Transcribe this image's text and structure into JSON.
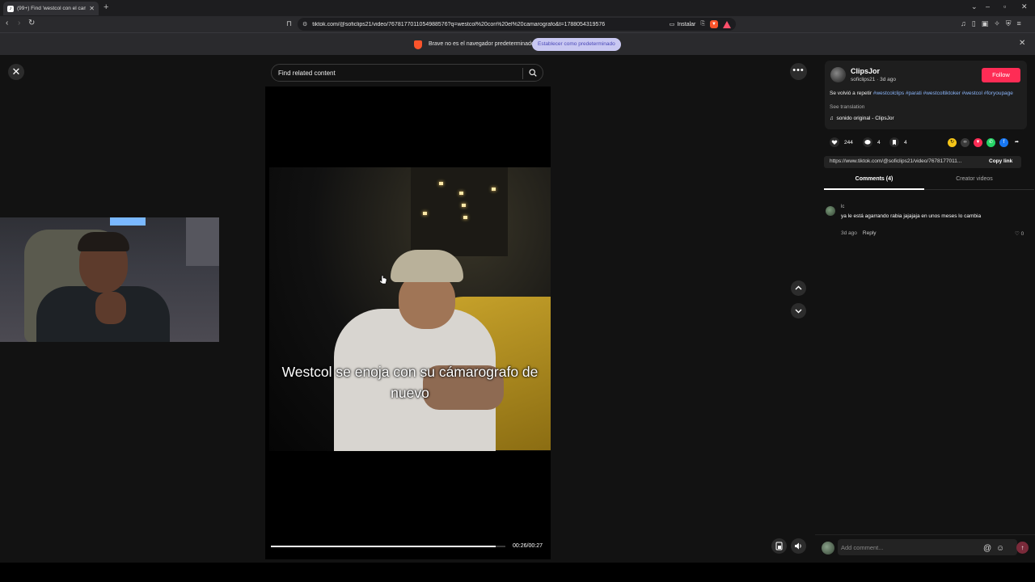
{
  "browser": {
    "tab_title": "(99+) Find 'westcol con el cam",
    "url": "tiktok.com/@soficlips21/video/7678177011054988576?q=westcol%20con%20el%20camarografo&t=1788054319576",
    "install_label": "Instalar",
    "infobar_message": "Brave no es el navegador predeterminado",
    "infobar_button": "Establecer como predeterminado"
  },
  "search": {
    "placeholder": "Find related content"
  },
  "video": {
    "caption": "Westcol se enoja con su cámarografo de nuevo",
    "time": "00:26/00:27",
    "progress": 0.96
  },
  "creator": {
    "name": "ClipsJor",
    "handle": "soficlips21 · 3d ago",
    "follow_label": "Follow",
    "desc_text": "Se volvió a repetir ",
    "hashtags": "#westcolclips #parati #westcoltiktoker #westcol #foryoupage",
    "see_translation": "See translation",
    "sound": "sonido original - ClipsJor"
  },
  "stats": {
    "likes": "244",
    "comments": "4",
    "saves": "4"
  },
  "share": {
    "link": "https://www.tiktok.com/@soficlips21/video/7678177011...",
    "copy_label": "Copy link"
  },
  "tabs": {
    "comments": "Comments (4)",
    "creator_videos": "Creator videos"
  },
  "comments": [
    {
      "user": "lc",
      "text": "ya le está agarrando rabia jajajaja en unos meses lo cambia",
      "time": "3d ago",
      "reply": "Reply",
      "likes": "0"
    }
  ],
  "comment_input": {
    "placeholder": "Add comment..."
  },
  "colors": {
    "follow": "#fe2c55",
    "hashtag": "#8ab4f8",
    "background": "#121212"
  }
}
